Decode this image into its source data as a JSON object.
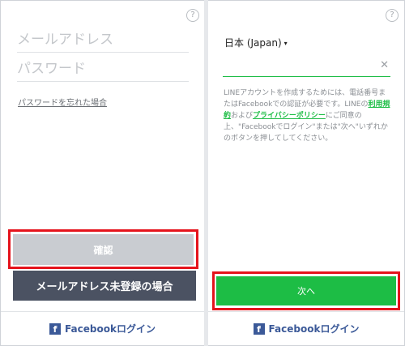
{
  "left_screen": {
    "help_icon": "?",
    "email_placeholder": "メールアドレス",
    "password_placeholder": "パスワード",
    "forgot_password": "パスワードを忘れた場合",
    "confirm_button": "確認",
    "no_email_button": "メールアドレス未登録の場合",
    "facebook_icon_glyph": "f",
    "facebook_login": "Facebookログイン"
  },
  "right_screen": {
    "help_icon": "?",
    "country": "日本 (Japan)",
    "country_caret": "▾",
    "clear_icon": "✕",
    "notice": {
      "part1": "LINEアカウントを作成するためには、電話番号またはFacebookでの認証が必要です。LINEの",
      "terms_link": "利用規約",
      "part2": "および",
      "privacy_link": "プライバシーポリシー",
      "part3": "にご同意の上、\"Facebookでログイン\"または\"次へ\"いずれかのボタンを押してしてください。"
    },
    "next_button": "次へ",
    "facebook_icon_glyph": "f",
    "facebook_login": "Facebookログイン"
  },
  "colors": {
    "line_green": "#1dbd45",
    "facebook_blue": "#3b5998",
    "highlight_red": "#e5131c",
    "dark_button": "#4b5262",
    "disabled_button": "#c9ccd1"
  }
}
